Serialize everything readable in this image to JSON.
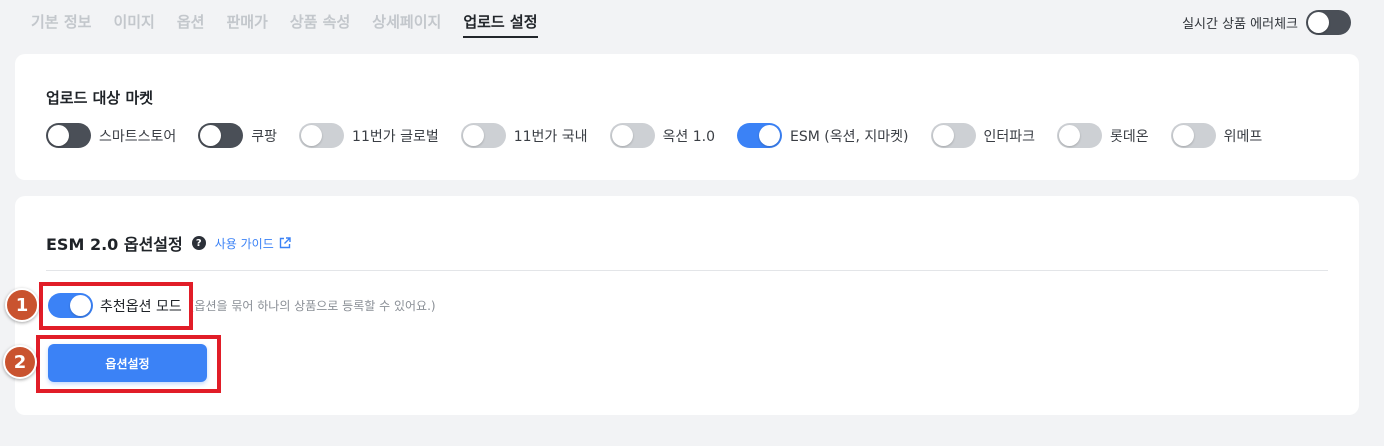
{
  "tabs": [
    {
      "label": "기본 정보",
      "active": false
    },
    {
      "label": "이미지",
      "active": false
    },
    {
      "label": "옵션",
      "active": false
    },
    {
      "label": "판매가",
      "active": false
    },
    {
      "label": "상품 속성",
      "active": false
    },
    {
      "label": "상세페이지",
      "active": false
    },
    {
      "label": "업로드 설정",
      "active": true
    }
  ],
  "realtime_check": {
    "label": "실시간 상품 에러체크",
    "enabled": false
  },
  "markets_card": {
    "title": "업로드 대상 마켓",
    "markets": [
      {
        "label": "스마트스토어",
        "enabled": false
      },
      {
        "label": "쿠팡",
        "enabled": false
      },
      {
        "label": "11번가 글로벌",
        "enabled": false
      },
      {
        "label": "11번가 국내",
        "enabled": false
      },
      {
        "label": "옥션 1.0",
        "enabled": false
      },
      {
        "label": "ESM (옥션, 지마켓)",
        "enabled": true
      },
      {
        "label": "인터파크",
        "enabled": false
      },
      {
        "label": "롯데온",
        "enabled": false
      },
      {
        "label": "위메프",
        "enabled": false
      }
    ]
  },
  "esm_card": {
    "title": "ESM 2.0 옵션설정",
    "help_glyph": "?",
    "guide_label": "사용 가이드",
    "recommend": {
      "label": "추천옵션 모드",
      "hint": "(옵션을 묶어 하나의 상품으로 등록할 수 있어요.)",
      "enabled": true
    },
    "option_button": "옵션설정"
  },
  "annotations": {
    "badge_1": "1",
    "badge_2": "2"
  },
  "colors": {
    "accent": "#3b82f6",
    "highlight": "#e11d28",
    "badge": "#c9532f",
    "toggle_off_dark": "#4a4f57",
    "toggle_off_light": "#cdd0d4"
  }
}
